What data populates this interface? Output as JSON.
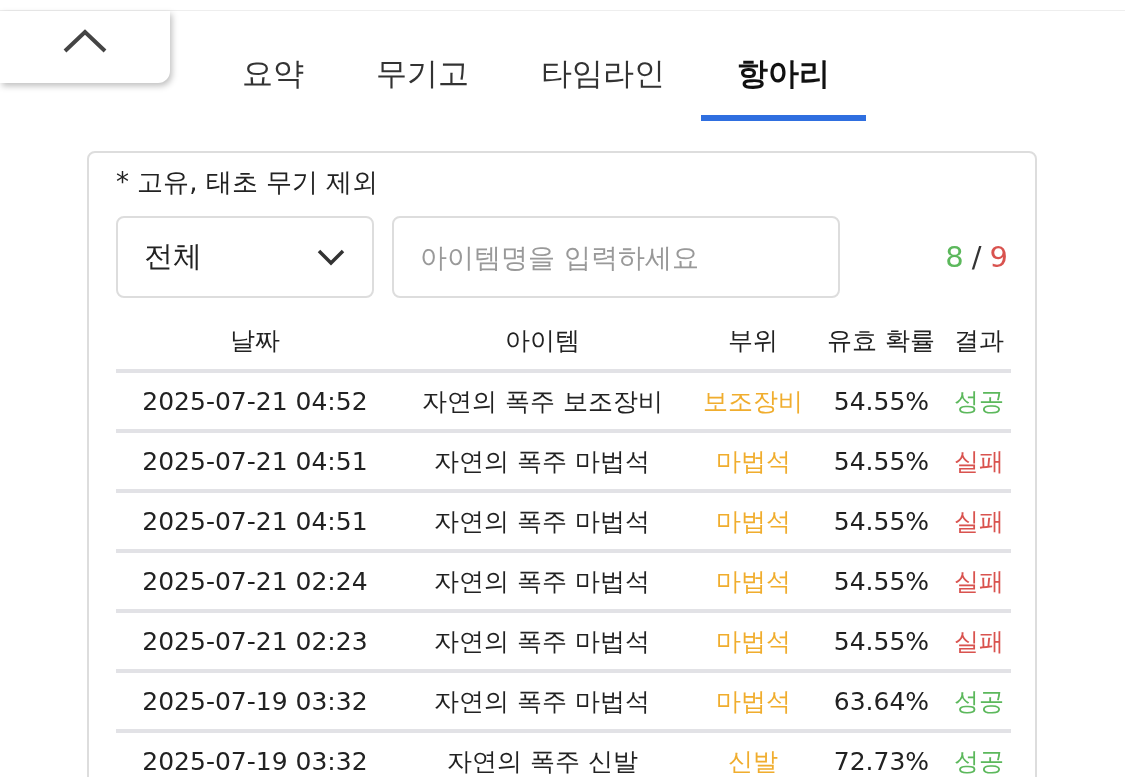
{
  "tabs": [
    {
      "label": "요약",
      "selected": false
    },
    {
      "label": "무기고",
      "selected": false
    },
    {
      "label": "타임라인",
      "selected": false
    },
    {
      "label": "항아리",
      "selected": true
    }
  ],
  "note": "* 고유, 태초 무기 제외",
  "filter": {
    "value": "전체"
  },
  "search": {
    "placeholder": "아이템명을 입력하세요"
  },
  "count": {
    "success": "8",
    "separator": "/",
    "fail": "9"
  },
  "table": {
    "columns": [
      "날짜",
      "아이템",
      "부위",
      "유효 확률",
      "결과"
    ],
    "rows": [
      {
        "date": "2025-07-21 04:52",
        "item": "자연의 폭주 보조장비",
        "part": "보조장비",
        "probability": "54.55%",
        "result": "성공",
        "color": "#5cb85c"
      },
      {
        "date": "2025-07-21 04:51",
        "item": "자연의 폭주 마법석",
        "part": "마법석",
        "probability": "54.55%",
        "result": "실패",
        "color": "#d9534f"
      },
      {
        "date": "2025-07-21 04:51",
        "item": "자연의 폭주 마법석",
        "part": "마법석",
        "probability": "54.55%",
        "result": "실패",
        "color": "#d9534f"
      },
      {
        "date": "2025-07-21 02:24",
        "item": "자연의 폭주 마법석",
        "part": "마법석",
        "probability": "54.55%",
        "result": "실패",
        "color": "#d9534f"
      },
      {
        "date": "2025-07-21 02:23",
        "item": "자연의 폭주 마법석",
        "part": "마법석",
        "probability": "54.55%",
        "result": "실패",
        "color": "#d9534f"
      },
      {
        "date": "2025-07-19 03:32",
        "item": "자연의 폭주 마법석",
        "part": "마법석",
        "probability": "63.64%",
        "result": "성공",
        "color": "#5cb85c"
      },
      {
        "date": "2025-07-19 03:32",
        "item": "자연의 폭주 신발",
        "part": "신발",
        "probability": "72.73%",
        "result": "성공",
        "color": "#5cb85c"
      }
    ]
  }
}
